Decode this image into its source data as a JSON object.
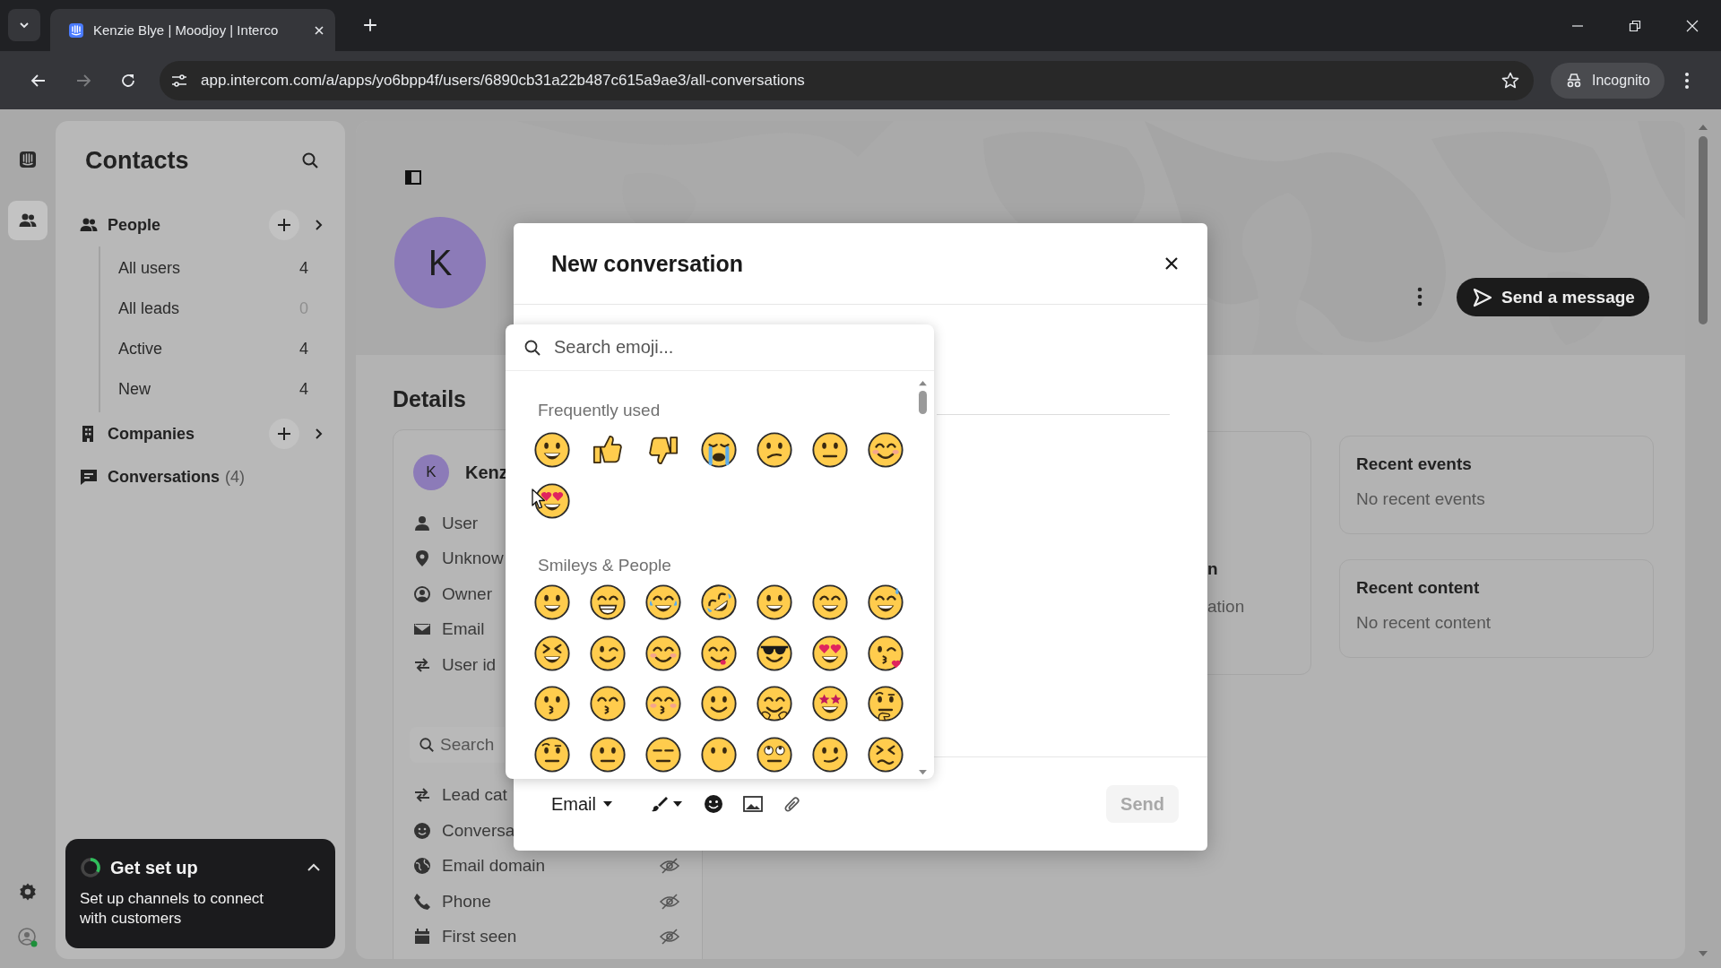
{
  "browser": {
    "tab_title": "Kenzie Blye | Moodjoy | Interco",
    "url": "app.intercom.com/a/apps/yo6bpp4f/users/6890cb31a22b487c615a9ae3/all-conversations",
    "profile_label": "Incognito"
  },
  "rail": {
    "items": [
      {
        "kind": "inbox",
        "selected": false
      },
      {
        "kind": "contacts",
        "selected": true
      }
    ]
  },
  "sidebar": {
    "title": "Contacts",
    "sections": [
      {
        "kind": "people",
        "label": "People",
        "children": [
          {
            "label": "All users",
            "count": "4",
            "muted": false
          },
          {
            "label": "All leads",
            "count": "0",
            "muted": true
          },
          {
            "label": "Active",
            "count": "4",
            "muted": false
          },
          {
            "label": "New",
            "count": "4",
            "muted": false
          }
        ]
      },
      {
        "kind": "companies",
        "label": "Companies"
      },
      {
        "kind": "conversations",
        "label": "Conversations",
        "count": "(4)"
      }
    ]
  },
  "setup_card": {
    "title": "Get set up",
    "text": "Set up channels to connect with customers"
  },
  "profile": {
    "avatar_letter": "K",
    "send_button": "Send a message"
  },
  "details": {
    "heading": "Details",
    "avatar_letter": "K",
    "name": "Kenz",
    "attributes": [
      {
        "kind": "user",
        "label": "User"
      },
      {
        "kind": "location",
        "label": "Unknow"
      },
      {
        "kind": "owner",
        "label": "Owner"
      },
      {
        "kind": "email",
        "label": "Email"
      },
      {
        "kind": "id",
        "label": "User id"
      }
    ],
    "search_placeholder": "Search",
    "properties": [
      {
        "kind": "id",
        "label": "Lead cat"
      },
      {
        "kind": "conversation",
        "label": "Conversa"
      },
      {
        "kind": "domain",
        "label": "Email domain",
        "hidden": true
      },
      {
        "kind": "phone",
        "label": "Phone",
        "hidden": true
      },
      {
        "kind": "calendar",
        "label": "First seen",
        "hidden": true
      }
    ]
  },
  "partial_card": {
    "title": "n",
    "text": "ation"
  },
  "recent": [
    {
      "title": "Recent events",
      "text": "No recent events"
    },
    {
      "title": "Recent content",
      "text": "No recent content"
    }
  ],
  "modal": {
    "title": "New conversation",
    "channel": "Email",
    "send": "Send",
    "send_disabled": true
  },
  "emoji_picker": {
    "placeholder": "Search emoji...",
    "groups": [
      {
        "title": "Frequently used",
        "emojis": [
          {
            "kind": "grin"
          },
          {
            "kind": "thumbs-up"
          },
          {
            "kind": "thumbs-down"
          },
          {
            "kind": "crying"
          },
          {
            "kind": "confused"
          },
          {
            "kind": "neutral"
          },
          {
            "kind": "blush"
          },
          {
            "kind": "heart-eyes"
          }
        ]
      },
      {
        "title": "Smileys & People",
        "emojis": [
          {
            "kind": "grin"
          },
          {
            "kind": "beam"
          },
          {
            "kind": "joy"
          },
          {
            "kind": "rofl"
          },
          {
            "kind": "smiley"
          },
          {
            "kind": "smile"
          },
          {
            "kind": "sweat"
          },
          {
            "kind": "laughing"
          },
          {
            "kind": "wink"
          },
          {
            "kind": "blush"
          },
          {
            "kind": "yum"
          },
          {
            "kind": "cool"
          },
          {
            "kind": "heart-eyes"
          },
          {
            "kind": "kiss-heart"
          },
          {
            "kind": "kissing"
          },
          {
            "kind": "kissing-smile"
          },
          {
            "kind": "kissing-closed"
          },
          {
            "kind": "slight"
          },
          {
            "kind": "hug"
          },
          {
            "kind": "star"
          },
          {
            "kind": "thinking"
          },
          {
            "kind": "raised"
          },
          {
            "kind": "neutral"
          },
          {
            "kind": "expressionless"
          },
          {
            "kind": "nomouth"
          },
          {
            "kind": "rolling"
          },
          {
            "kind": "smirk"
          },
          {
            "kind": "persevere"
          }
        ]
      }
    ]
  }
}
